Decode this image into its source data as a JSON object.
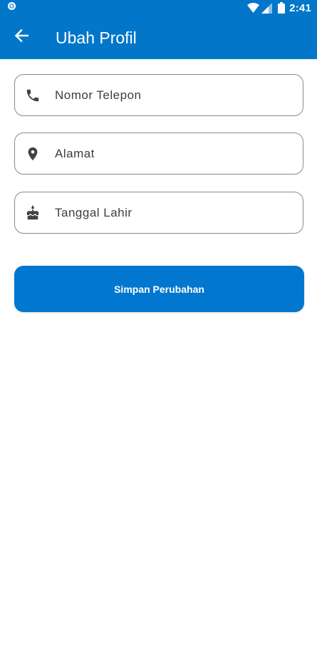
{
  "status_bar": {
    "time": "2:41",
    "icons": [
      "notification-circle-icon",
      "wifi-icon",
      "cell-signal-icon",
      "battery-icon"
    ],
    "color": "#0277c9"
  },
  "app_bar": {
    "title": "Ubah Profil",
    "back_icon": "arrow-left-icon",
    "color": "#0277c9"
  },
  "form": {
    "phone": {
      "placeholder": "Nomor Telepon",
      "value": "",
      "icon": "phone-icon"
    },
    "address": {
      "placeholder": "Alamat",
      "value": "",
      "icon": "location-pin-icon"
    },
    "birthdate": {
      "placeholder": "Tanggal Lahir",
      "value": "",
      "icon": "cake-icon"
    }
  },
  "save_button": {
    "label": "Simpan Perubahan",
    "color": "#0277cf"
  }
}
